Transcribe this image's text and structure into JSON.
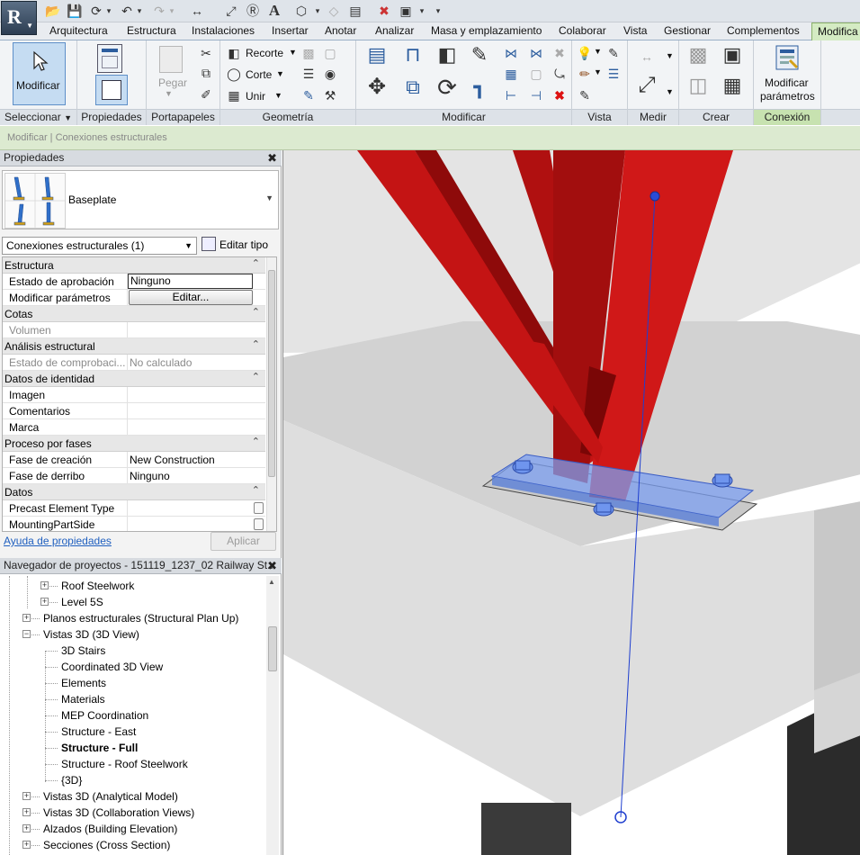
{
  "app": {
    "button_letter": "R"
  },
  "tabs": [
    {
      "label": "Arquitectura"
    },
    {
      "label": "Estructura"
    },
    {
      "label": "Instalaciones"
    },
    {
      "label": "Insertar"
    },
    {
      "label": "Anotar"
    },
    {
      "label": "Analizar"
    },
    {
      "label": "Masa y emplazamiento"
    },
    {
      "label": "Colaborar"
    },
    {
      "label": "Vista"
    },
    {
      "label": "Gestionar"
    },
    {
      "label": "Complementos"
    },
    {
      "label": "Modifica",
      "active": true
    }
  ],
  "ribbon": {
    "modify_button": "Modificar",
    "paste_button": "Pegar",
    "geometry": {
      "cope": "Recorte",
      "cut": "Corte",
      "join": "Unir"
    },
    "edit_params_line1": "Modificar",
    "edit_params_line2": "parámetros",
    "panels": {
      "select": "Seleccionar",
      "properties": "Propiedades",
      "clipboard": "Portapapeles",
      "geometry": "Geometría",
      "modify": "Modificar",
      "view": "Vista",
      "measure": "Medir",
      "create": "Crear",
      "connection": "Conexión"
    }
  },
  "options_bar": {
    "text": "Modificar | Conexiones estructurales"
  },
  "properties": {
    "title": "Propiedades",
    "type_name": "Baseplate",
    "filter": "Conexiones estructurales (1)",
    "edit_type": "Editar tipo",
    "rows": [
      {
        "group": "Estructura"
      },
      {
        "key": "Estado de aprobación",
        "value": "Ninguno",
        "style": "box"
      },
      {
        "key": "Modificar parámetros",
        "value": "Editar...",
        "style": "button"
      },
      {
        "group": "Cotas"
      },
      {
        "key": "Volumen",
        "value": "",
        "dim": true
      },
      {
        "group": "Análisis estructural"
      },
      {
        "key": "Estado de comprobaci...",
        "value": "No calculado",
        "dim": true
      },
      {
        "group": "Datos de identidad"
      },
      {
        "key": "Imagen",
        "value": ""
      },
      {
        "key": "Comentarios",
        "value": ""
      },
      {
        "key": "Marca",
        "value": ""
      },
      {
        "group": "Proceso por fases"
      },
      {
        "key": "Fase de creación",
        "value": "New Construction"
      },
      {
        "key": "Fase de derribo",
        "value": "Ninguno"
      },
      {
        "group": "Datos"
      },
      {
        "key": "Precast Element Type",
        "value": "",
        "checkbox": true
      },
      {
        "key": "MountingPartSide",
        "value": "",
        "checkbox": true
      }
    ],
    "help_link": "Ayuda de propiedades",
    "apply": "Aplicar"
  },
  "browser": {
    "title": "Navegador de proyectos - 151119_1237_02 Railway St...",
    "items": [
      {
        "label": "Roof Steelwork",
        "level": 2,
        "expander": "+"
      },
      {
        "label": "Level 5S",
        "level": 2,
        "expander": "+"
      },
      {
        "label": "Planos estructurales (Structural Plan Up)",
        "level": 1,
        "expander": "+"
      },
      {
        "label": "Vistas 3D (3D View)",
        "level": 1,
        "expander": "-"
      },
      {
        "label": "3D Stairs",
        "level": 2
      },
      {
        "label": "Coordinated 3D View",
        "level": 2
      },
      {
        "label": "Elements",
        "level": 2
      },
      {
        "label": "Materials",
        "level": 2
      },
      {
        "label": "MEP Coordination",
        "level": 2
      },
      {
        "label": "Structure - East",
        "level": 2
      },
      {
        "label": "Structure - Full",
        "level": 2,
        "bold": true
      },
      {
        "label": "Structure - Roof Steelwork",
        "level": 2
      },
      {
        "label": "{3D}",
        "level": 2
      },
      {
        "label": "Vistas 3D (Analytical Model)",
        "level": 1,
        "expander": "+"
      },
      {
        "label": "Vistas 3D (Collaboration Views)",
        "level": 1,
        "expander": "+"
      },
      {
        "label": "Alzados (Building Elevation)",
        "level": 1,
        "expander": "+"
      },
      {
        "label": "Secciones (Cross Section)",
        "level": 1,
        "expander": "+"
      }
    ]
  },
  "colors": {
    "steel": "#d01818",
    "steel_dark": "#8e0a0a",
    "plate": "#7c9ff0",
    "concrete": "#dcdcdc",
    "analytical_line": "#1f3fcf"
  }
}
